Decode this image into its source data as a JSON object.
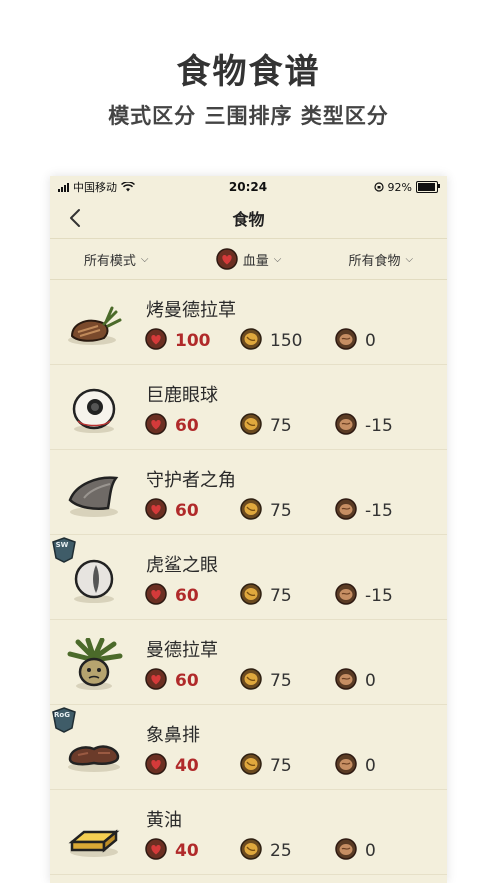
{
  "promo": {
    "title": "食物食谱",
    "subtitle": "模式区分  三围排序  类型区分"
  },
  "status_bar": {
    "carrier": "中国移动",
    "time": "20:24",
    "battery": "92%"
  },
  "nav": {
    "title": "食物"
  },
  "filters": {
    "mode": "所有模式",
    "sort": "血量",
    "type": "所有食物"
  },
  "foods": [
    {
      "name": "烤曼德拉草",
      "health": "100",
      "hunger": "150",
      "sanity": "0",
      "icon": "cooked-mandrake-icon",
      "badge": ""
    },
    {
      "name": "巨鹿眼球",
      "health": "60",
      "hunger": "75",
      "sanity": "-15",
      "icon": "eyeball-icon",
      "badge": ""
    },
    {
      "name": "守护者之角",
      "health": "60",
      "hunger": "75",
      "sanity": "-15",
      "icon": "horn-icon",
      "badge": ""
    },
    {
      "name": "虎鲨之眼",
      "health": "60",
      "hunger": "75",
      "sanity": "-15",
      "icon": "shark-eye-icon",
      "badge": "SW"
    },
    {
      "name": "曼德拉草",
      "health": "60",
      "hunger": "75",
      "sanity": "0",
      "icon": "mandrake-icon",
      "badge": ""
    },
    {
      "name": "象鼻排",
      "health": "40",
      "hunger": "75",
      "sanity": "0",
      "icon": "trunk-steak-icon",
      "badge": "RoG"
    },
    {
      "name": "黄油",
      "health": "40",
      "hunger": "25",
      "sanity": "0",
      "icon": "butter-icon",
      "badge": ""
    }
  ],
  "colors": {
    "background": "#f3efdc",
    "health": "#b02a2a",
    "hunger": "#d9a441",
    "sanity": "#b9835a",
    "badge": "#4d6d7a"
  }
}
